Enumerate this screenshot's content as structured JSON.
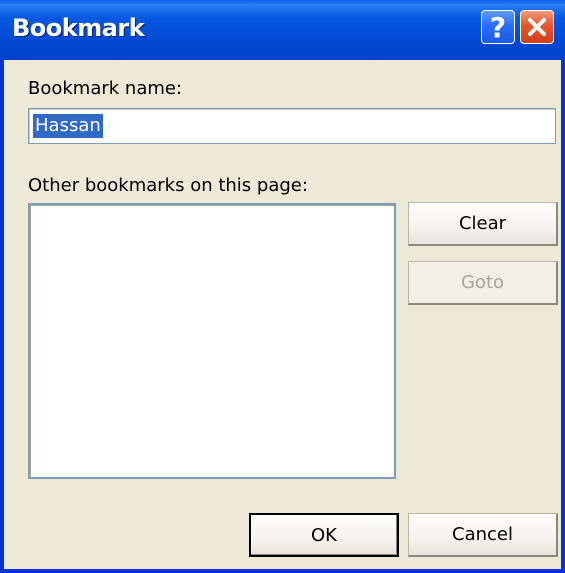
{
  "window": {
    "title": "Bookmark",
    "help_glyph": "?",
    "close_glyph": "✕"
  },
  "form": {
    "name_label": "Bookmark name:",
    "name_value": "Hassan",
    "other_label": "Other bookmarks on this page:",
    "other_items": []
  },
  "buttons": {
    "clear": "Clear",
    "goto": "Goto",
    "ok": "OK",
    "cancel": "Cancel"
  },
  "colors": {
    "titlebar": "#0658e0",
    "dialog_bg": "#ece9d8",
    "selection": "#316ac5",
    "close_button": "#e4572f"
  }
}
